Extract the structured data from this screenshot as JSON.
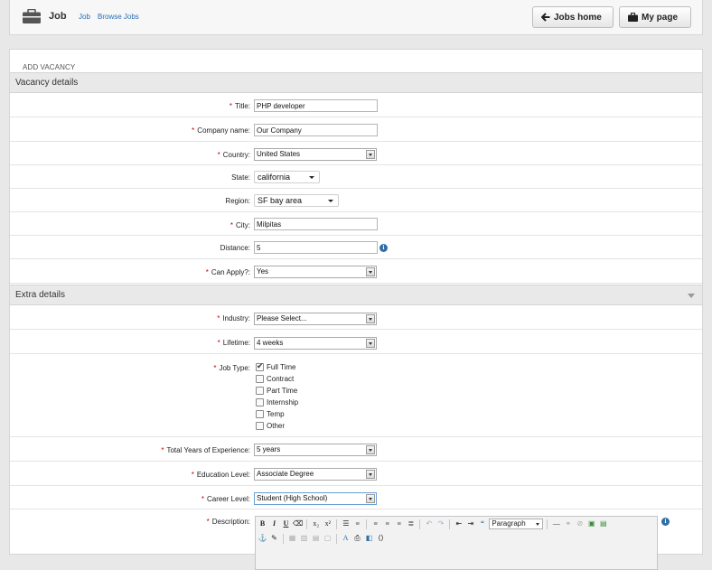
{
  "header": {
    "title": "Job",
    "crumbs": [
      "Job",
      "Browse Jobs"
    ],
    "jobs_home_label": "Jobs home",
    "my_page_label": "My page"
  },
  "form": {
    "heading": "ADD VACANCY",
    "section_vacancy": "Vacancy details",
    "section_extra": "Extra details",
    "required_mark": "*",
    "title_label": "Title:",
    "title_value": "PHP developer",
    "company_label": "Company name:",
    "company_value": "Our Company",
    "country_label": "Country:",
    "country_value": "United States",
    "state_label": "State:",
    "state_value": "california",
    "region_label": "Region:",
    "region_value": "SF bay area",
    "city_label": "City:",
    "city_value": "Milpitas",
    "distance_label": "Distance:",
    "distance_value": "5",
    "can_apply_label": "Can Apply?:",
    "can_apply_value": "Yes",
    "industry_label": "Industry:",
    "industry_value": "Please Select...",
    "lifetime_label": "Lifetime:",
    "lifetime_value": "4 weeks",
    "job_type_label": "Job Type:",
    "job_types": [
      {
        "label": "Full Time",
        "checked": true
      },
      {
        "label": "Contract",
        "checked": false
      },
      {
        "label": "Part Time",
        "checked": false
      },
      {
        "label": "Internship",
        "checked": false
      },
      {
        "label": "Temp",
        "checked": false
      },
      {
        "label": "Other",
        "checked": false
      }
    ],
    "experience_label": "Total Years of Experience:",
    "experience_value": "5 years",
    "education_label": "Education Level:",
    "education_value": "Associate Degree",
    "career_label": "Career Level:",
    "career_value": "Student (High School)",
    "description_label": "Description:",
    "editor_format_value": "Paragraph"
  },
  "icons": {
    "info": "i",
    "back_arrow": "arrow-left-icon",
    "briefcase": "briefcase-icon"
  },
  "colors": {
    "required": "#cc0000",
    "link": "#2a6fb5",
    "info": "#2f6ea7"
  }
}
